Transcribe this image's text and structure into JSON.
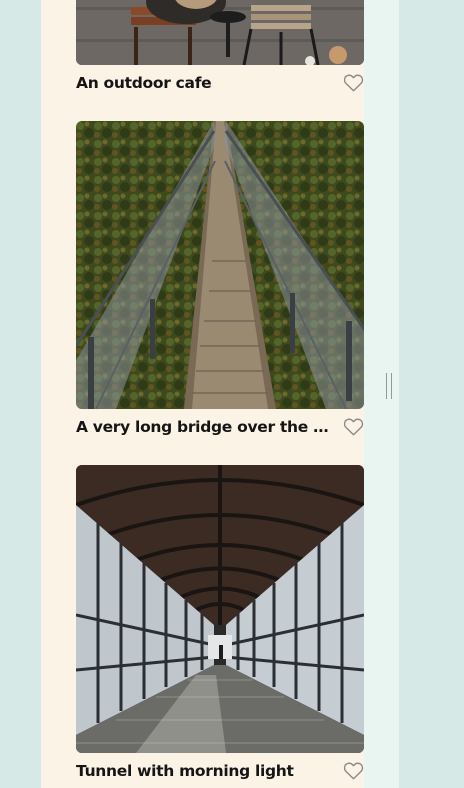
{
  "cards": [
    {
      "caption": "An outdoor cafe",
      "like_icon": "heart-outline-icon"
    },
    {
      "caption": "A very long bridge over the forest",
      "like_icon": "heart-outline-icon"
    },
    {
      "caption": "Tunnel with morning light",
      "like_icon": "heart-outline-icon"
    }
  ],
  "colors": {
    "background": "#d7e9e7",
    "feed_background": "#fbf3e6",
    "side_strip": "#e8f5f1",
    "caption_text": "#151515",
    "heart_stroke": "#8a8a8a"
  }
}
